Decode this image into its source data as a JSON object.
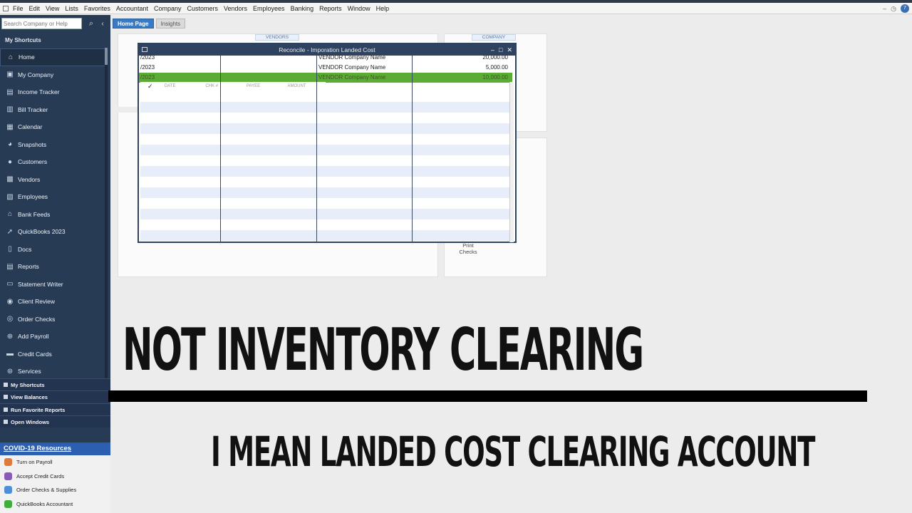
{
  "menubar": {
    "items": [
      "File",
      "Edit",
      "View",
      "Lists",
      "Favorites",
      "Accountant",
      "Company",
      "Customers",
      "Vendors",
      "Employees",
      "Banking",
      "Reports",
      "Window",
      "Help"
    ],
    "badge": "7"
  },
  "sidebar": {
    "search_placeholder": "Search Company or Help",
    "shortcuts_title": "My Shortcuts",
    "items": [
      {
        "label": "Home",
        "icon": "home-icon"
      },
      {
        "label": "My Company",
        "icon": "company-icon"
      },
      {
        "label": "Income Tracker",
        "icon": "income-tracker-icon"
      },
      {
        "label": "Bill Tracker",
        "icon": "bill-tracker-icon"
      },
      {
        "label": "Calendar",
        "icon": "calendar-icon"
      },
      {
        "label": "Snapshots",
        "icon": "snapshots-icon"
      },
      {
        "label": "Customers",
        "icon": "customers-icon"
      },
      {
        "label": "Vendors",
        "icon": "vendors-icon"
      },
      {
        "label": "Employees",
        "icon": "employees-icon"
      },
      {
        "label": "Bank Feeds",
        "icon": "bank-icon"
      },
      {
        "label": "QuickBooks 2023",
        "icon": "quickbooks-icon"
      },
      {
        "label": "Docs",
        "icon": "docs-icon"
      },
      {
        "label": "Reports",
        "icon": "reports-icon"
      },
      {
        "label": "Statement Writer",
        "icon": "statement-writer-icon"
      },
      {
        "label": "Client Review",
        "icon": "client-review-icon"
      },
      {
        "label": "Order Checks",
        "icon": "order-checks-icon"
      },
      {
        "label": "Add Payroll",
        "icon": "add-payroll-icon"
      },
      {
        "label": "Credit Cards",
        "icon": "credit-cards-icon"
      },
      {
        "label": "Services",
        "icon": "services-icon"
      }
    ],
    "sections": [
      "My Shortcuts",
      "View Balances",
      "Run Favorite Reports",
      "Open Windows"
    ],
    "covid_header": "COVID-19 Resources",
    "resources": [
      {
        "label": "Turn on Payroll",
        "color": "#e0793a"
      },
      {
        "label": "Accept Credit Cards",
        "color": "#8a5ab8"
      },
      {
        "label": "Order Checks & Supplies",
        "color": "#4d8fd6"
      },
      {
        "label": "QuickBooks Accountant",
        "color": "#3fae3f"
      }
    ]
  },
  "tabs": {
    "home": "Home Page",
    "insights": "Insights"
  },
  "home": {
    "vendors_label": "VENDORS",
    "company_label": "COMPANY",
    "print_checks": "Print Checks"
  },
  "dialog": {
    "title": "Reconcile - Imporation Landed Cost",
    "rows": [
      {
        "date": "/2023",
        "name": "VENDOR Company Name",
        "amount": "20,000.00"
      },
      {
        "date": "/2023",
        "name": "VENDOR Company Name",
        "amount": "5,000.00"
      },
      {
        "date": "/2023",
        "name": "VENDOR Company Name",
        "amount": "10,000.00"
      }
    ],
    "columns": [
      "DATE",
      "CHK #",
      "PAYEE",
      "AMOUNT"
    ],
    "check_mark": "✓"
  },
  "captions": {
    "main": "NOT INVENTORY CLEARING",
    "sub": "I MEAN LANDED COST CLEARING ACCOUNT"
  },
  "colors": {
    "sidebar_bg": "#283b55",
    "dialog_title_bg": "#2f4360",
    "highlight_row": "#5bab34",
    "covid_header": "#2d5fb0"
  }
}
